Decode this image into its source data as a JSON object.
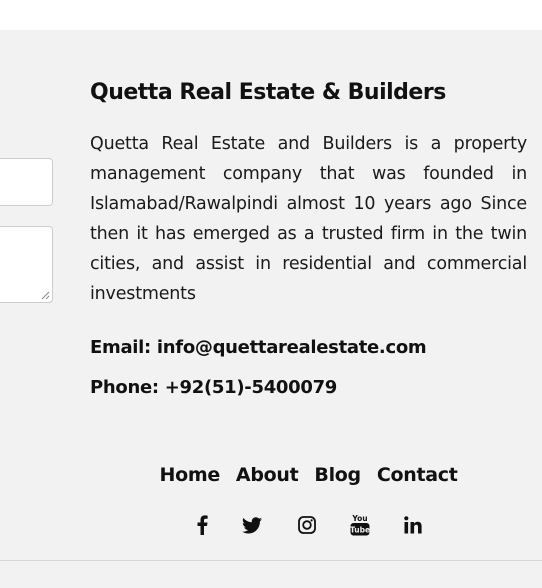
{
  "company": {
    "title": "Quetta Real Estate & Builders",
    "description": "Quetta Real Estate and Builders is a property management company that was founded in Islamabad/Rawalpindi almost 10 years ago Since then it has emerged as a trusted firm in the twin cities, and assist in residential and commercial investments"
  },
  "contact": {
    "email_line": "Email: info@quettarealestate.com",
    "phone_line": "Phone: +92(51)-5400079"
  },
  "nav": {
    "home": "Home",
    "about": "About",
    "blog": "Blog",
    "contact": "Contact"
  },
  "social": {
    "youtube_text": "You Tube",
    "icons": [
      "facebook-icon",
      "twitter-icon",
      "instagram-icon",
      "youtube-icon",
      "linkedin-icon"
    ]
  },
  "colors": {
    "background": "#f2f2f2",
    "text": "#111111",
    "divider": "#d6d6d6"
  }
}
